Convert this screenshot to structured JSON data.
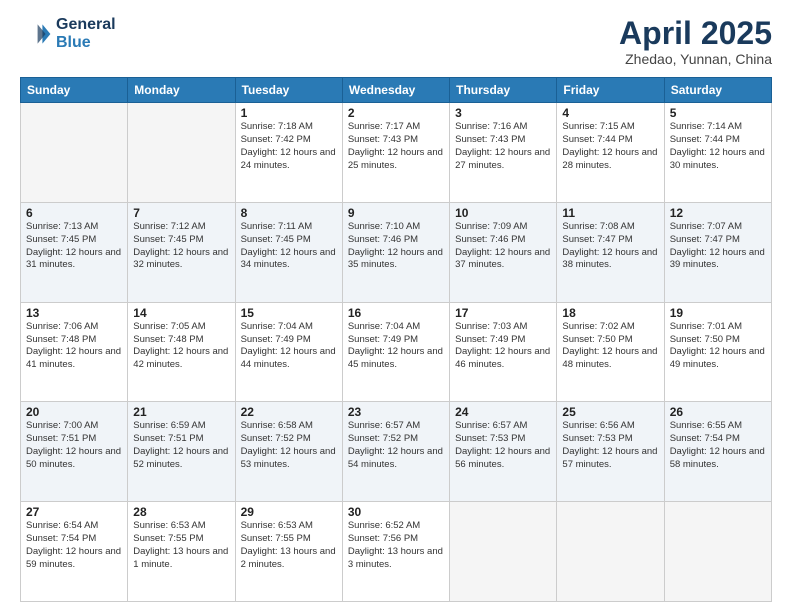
{
  "logo": {
    "line1": "General",
    "line2": "Blue"
  },
  "title": "April 2025",
  "subtitle": "Zhedao, Yunnan, China",
  "days_of_week": [
    "Sunday",
    "Monday",
    "Tuesday",
    "Wednesday",
    "Thursday",
    "Friday",
    "Saturday"
  ],
  "weeks": [
    [
      {
        "day": "",
        "info": ""
      },
      {
        "day": "",
        "info": ""
      },
      {
        "day": "1",
        "info": "Sunrise: 7:18 AM\nSunset: 7:42 PM\nDaylight: 12 hours and 24 minutes."
      },
      {
        "day": "2",
        "info": "Sunrise: 7:17 AM\nSunset: 7:43 PM\nDaylight: 12 hours and 25 minutes."
      },
      {
        "day": "3",
        "info": "Sunrise: 7:16 AM\nSunset: 7:43 PM\nDaylight: 12 hours and 27 minutes."
      },
      {
        "day": "4",
        "info": "Sunrise: 7:15 AM\nSunset: 7:44 PM\nDaylight: 12 hours and 28 minutes."
      },
      {
        "day": "5",
        "info": "Sunrise: 7:14 AM\nSunset: 7:44 PM\nDaylight: 12 hours and 30 minutes."
      }
    ],
    [
      {
        "day": "6",
        "info": "Sunrise: 7:13 AM\nSunset: 7:45 PM\nDaylight: 12 hours and 31 minutes."
      },
      {
        "day": "7",
        "info": "Sunrise: 7:12 AM\nSunset: 7:45 PM\nDaylight: 12 hours and 32 minutes."
      },
      {
        "day": "8",
        "info": "Sunrise: 7:11 AM\nSunset: 7:45 PM\nDaylight: 12 hours and 34 minutes."
      },
      {
        "day": "9",
        "info": "Sunrise: 7:10 AM\nSunset: 7:46 PM\nDaylight: 12 hours and 35 minutes."
      },
      {
        "day": "10",
        "info": "Sunrise: 7:09 AM\nSunset: 7:46 PM\nDaylight: 12 hours and 37 minutes."
      },
      {
        "day": "11",
        "info": "Sunrise: 7:08 AM\nSunset: 7:47 PM\nDaylight: 12 hours and 38 minutes."
      },
      {
        "day": "12",
        "info": "Sunrise: 7:07 AM\nSunset: 7:47 PM\nDaylight: 12 hours and 39 minutes."
      }
    ],
    [
      {
        "day": "13",
        "info": "Sunrise: 7:06 AM\nSunset: 7:48 PM\nDaylight: 12 hours and 41 minutes."
      },
      {
        "day": "14",
        "info": "Sunrise: 7:05 AM\nSunset: 7:48 PM\nDaylight: 12 hours and 42 minutes."
      },
      {
        "day": "15",
        "info": "Sunrise: 7:04 AM\nSunset: 7:49 PM\nDaylight: 12 hours and 44 minutes."
      },
      {
        "day": "16",
        "info": "Sunrise: 7:04 AM\nSunset: 7:49 PM\nDaylight: 12 hours and 45 minutes."
      },
      {
        "day": "17",
        "info": "Sunrise: 7:03 AM\nSunset: 7:49 PM\nDaylight: 12 hours and 46 minutes."
      },
      {
        "day": "18",
        "info": "Sunrise: 7:02 AM\nSunset: 7:50 PM\nDaylight: 12 hours and 48 minutes."
      },
      {
        "day": "19",
        "info": "Sunrise: 7:01 AM\nSunset: 7:50 PM\nDaylight: 12 hours and 49 minutes."
      }
    ],
    [
      {
        "day": "20",
        "info": "Sunrise: 7:00 AM\nSunset: 7:51 PM\nDaylight: 12 hours and 50 minutes."
      },
      {
        "day": "21",
        "info": "Sunrise: 6:59 AM\nSunset: 7:51 PM\nDaylight: 12 hours and 52 minutes."
      },
      {
        "day": "22",
        "info": "Sunrise: 6:58 AM\nSunset: 7:52 PM\nDaylight: 12 hours and 53 minutes."
      },
      {
        "day": "23",
        "info": "Sunrise: 6:57 AM\nSunset: 7:52 PM\nDaylight: 12 hours and 54 minutes."
      },
      {
        "day": "24",
        "info": "Sunrise: 6:57 AM\nSunset: 7:53 PM\nDaylight: 12 hours and 56 minutes."
      },
      {
        "day": "25",
        "info": "Sunrise: 6:56 AM\nSunset: 7:53 PM\nDaylight: 12 hours and 57 minutes."
      },
      {
        "day": "26",
        "info": "Sunrise: 6:55 AM\nSunset: 7:54 PM\nDaylight: 12 hours and 58 minutes."
      }
    ],
    [
      {
        "day": "27",
        "info": "Sunrise: 6:54 AM\nSunset: 7:54 PM\nDaylight: 12 hours and 59 minutes."
      },
      {
        "day": "28",
        "info": "Sunrise: 6:53 AM\nSunset: 7:55 PM\nDaylight: 13 hours and 1 minute."
      },
      {
        "day": "29",
        "info": "Sunrise: 6:53 AM\nSunset: 7:55 PM\nDaylight: 13 hours and 2 minutes."
      },
      {
        "day": "30",
        "info": "Sunrise: 6:52 AM\nSunset: 7:56 PM\nDaylight: 13 hours and 3 minutes."
      },
      {
        "day": "",
        "info": ""
      },
      {
        "day": "",
        "info": ""
      },
      {
        "day": "",
        "info": ""
      }
    ]
  ]
}
